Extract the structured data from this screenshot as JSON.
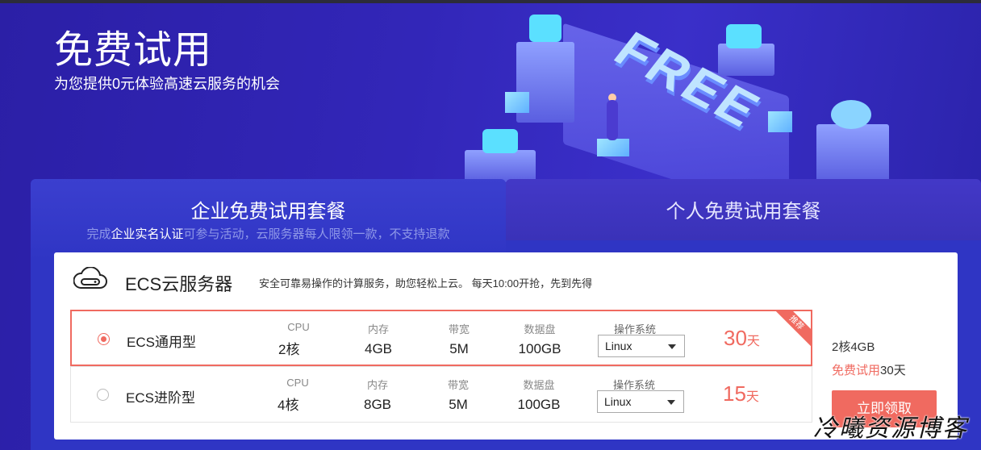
{
  "hero": {
    "title": "免费试用",
    "subtitle": "为您提供0元体验高速云服务的机会",
    "decor_text": "FREE"
  },
  "tabs": [
    {
      "label": "企业免费试用套餐",
      "active": true,
      "note_pre": "完成",
      "note_strong": "企业实名认证",
      "note_post": "可参与活动，云服务器每人限领一款，不支持退款"
    },
    {
      "label": "个人免费试用套餐",
      "active": false
    }
  ],
  "product": {
    "icon": "cloud-server-icon",
    "title": "ECS云服务器",
    "description": "安全可靠易操作的计算服务，助您轻松上云。 每天10:00开抢，先到先得"
  },
  "spec_labels": {
    "cpu": "CPU",
    "memory": "内存",
    "bandwidth": "带宽",
    "disk": "数据盘",
    "os": "操作系统"
  },
  "plans": [
    {
      "name": "ECS通用型",
      "selected": true,
      "badge": "推荐",
      "cpu": "2核",
      "memory": "4GB",
      "bandwidth": "5M",
      "disk": "100GB",
      "os": "Linux",
      "price_num": "30",
      "price_unit": "天"
    },
    {
      "name": "ECS进阶型",
      "selected": false,
      "cpu": "4核",
      "memory": "8GB",
      "bandwidth": "5M",
      "disk": "100GB",
      "os": "Linux",
      "price_num": "15",
      "price_unit": "天"
    }
  ],
  "summary": {
    "config": "2核4GB",
    "trial_label": "免费试用",
    "trial_days": "30天",
    "button_label": "立即领取"
  },
  "watermark": "冷曦资源博客",
  "colors": {
    "accent": "#f06a60",
    "brand_blue": "#2f35c4",
    "hero_bg": "#2b1fa6"
  }
}
